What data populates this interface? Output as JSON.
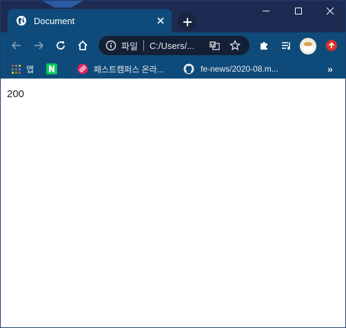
{
  "tab": {
    "title": "Document",
    "favicon": "globe-icon"
  },
  "window_controls": {
    "minimize": "minimize-icon",
    "maximize": "maximize-icon",
    "close": "close-icon"
  },
  "toolbar": {
    "back": "arrow-left-icon",
    "forward": "arrow-right-icon",
    "reload": "reload-icon",
    "home": "home-icon",
    "extensions": "puzzle-icon",
    "media": "media-queue-icon",
    "update": "update-arrow-icon"
  },
  "omnibox": {
    "chip": "파일",
    "url": "C:/Users/..."
  },
  "bookmarks": [
    {
      "label": "앱",
      "icon": "apps-grid-icon"
    },
    {
      "label": "",
      "icon": "naver-icon"
    },
    {
      "label": "패스트캠퍼스 온라...",
      "icon": "fastcampus-icon"
    },
    {
      "label": "fe-news/2020-08.m...",
      "icon": "github-icon"
    }
  ],
  "bookmarks_more": "»",
  "content": {
    "text": "200"
  },
  "colors": {
    "tab_strip": "#1d2b52",
    "toolbar": "#0f4b7a",
    "omnibox": "#142036"
  }
}
